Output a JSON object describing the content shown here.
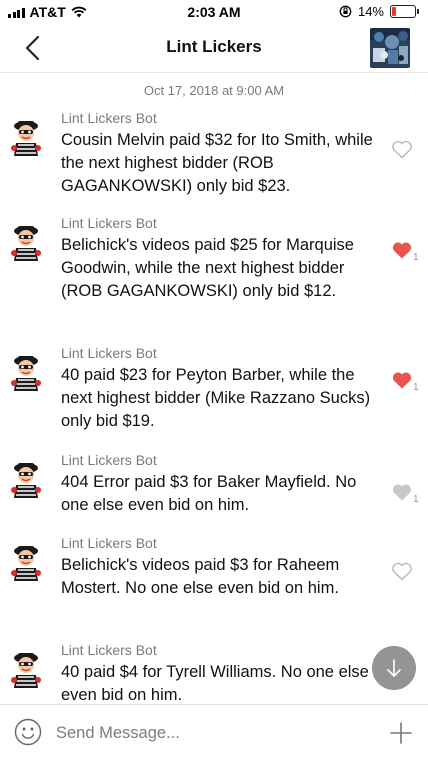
{
  "status_bar": {
    "carrier": "AT&T",
    "time": "2:03 AM",
    "battery": "14%"
  },
  "header": {
    "title": "Lint Lickers",
    "back_icon": "chevron-left-icon"
  },
  "date_separator": "Oct 17, 2018 at 9:00 AM",
  "messages": [
    {
      "sender": "Lint Lickers Bot",
      "text": "Cousin Melvin paid $32 for Ito Smith, while the next highest bidder (ROB GAGANKOWSKI) only bid $23.",
      "liked": false,
      "like_count": ""
    },
    {
      "sender": "Lint Lickers Bot",
      "text": "Belichick's videos paid $25 for Marquise Goodwin, while the next highest bidder (ROB GAGANKOWSKI) only bid $12.",
      "liked": true,
      "like_count": "1"
    },
    {
      "sender": "Lint Lickers Bot",
      "text": "40 paid $23 for Peyton Barber, while the next highest bidder (Mike Razzano Sucks) only bid $19.",
      "liked": true,
      "like_count": "1"
    },
    {
      "sender": "Lint Lickers Bot",
      "text": "404 Error paid $3 for Baker Mayfield. No one else even bid on him.",
      "liked": "grey",
      "like_count": "1"
    },
    {
      "sender": "Lint Lickers Bot",
      "text": "Belichick's videos paid $3 for Raheem Mostert. No one else even bid on him.",
      "liked": false,
      "like_count": ""
    },
    {
      "sender": "Lint Lickers Bot",
      "text": "40 paid $4 for Tyrell Williams. No one else even bid on him.",
      "liked": false,
      "like_count": ""
    }
  ],
  "composer": {
    "placeholder": "Send Message..."
  },
  "colors": {
    "like_red": "#e8554f",
    "like_grey": "#c8c8c8",
    "battery_low": "#e8392e"
  }
}
